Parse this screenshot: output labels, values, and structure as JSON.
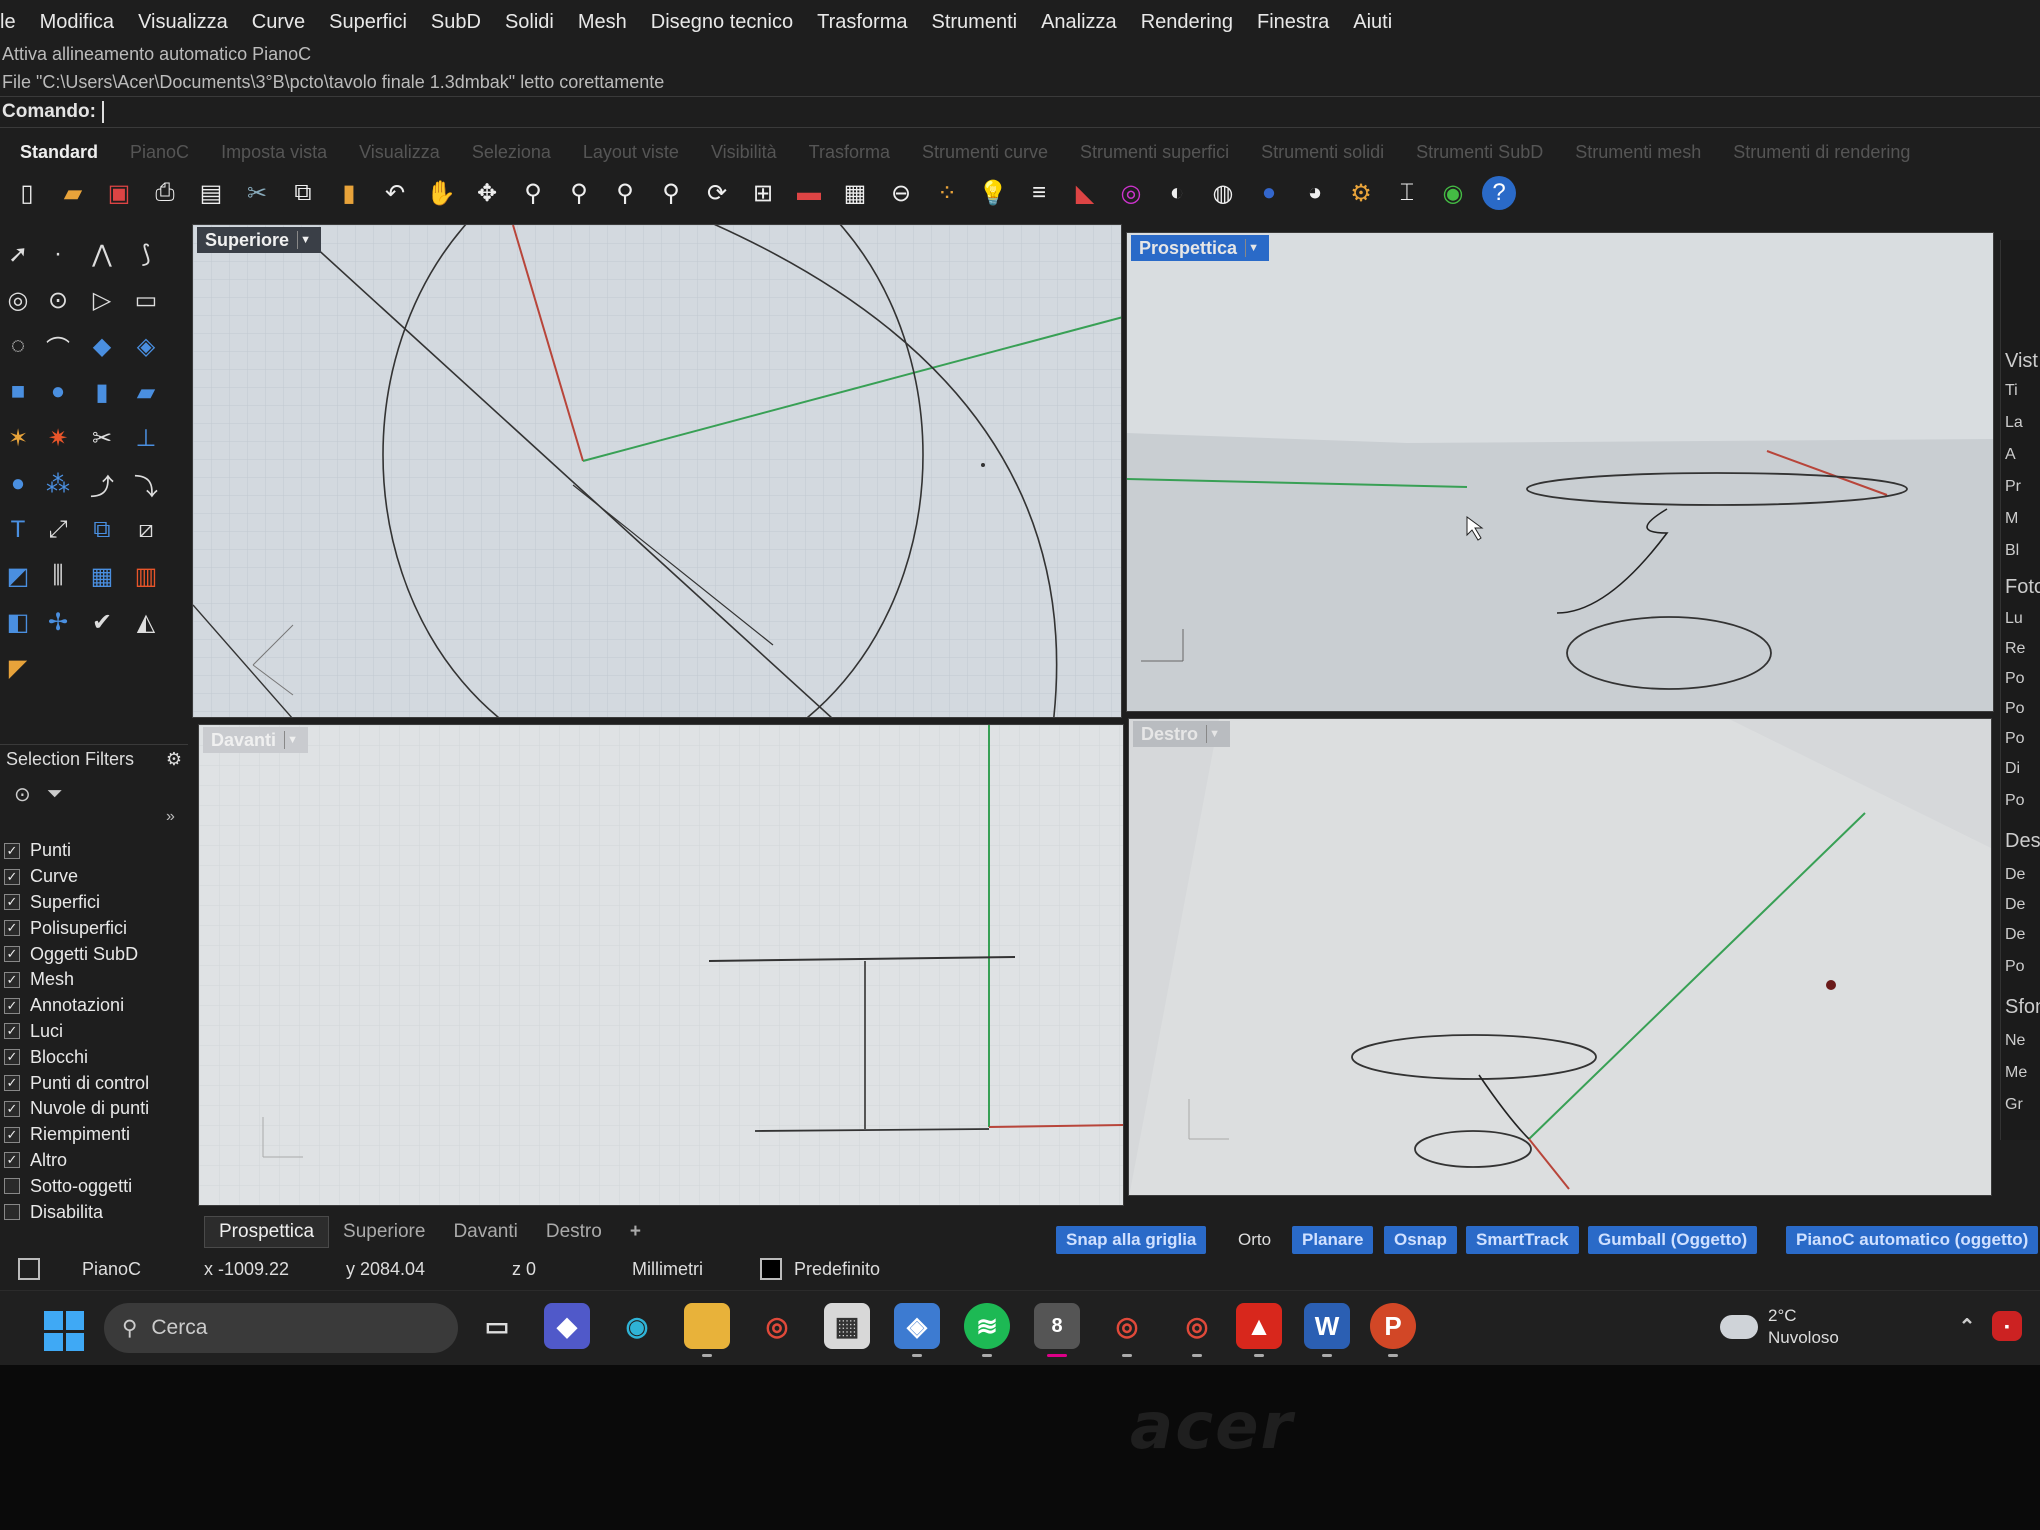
{
  "menu": [
    "le",
    "Modifica",
    "Visualizza",
    "Curve",
    "Superfici",
    "SubD",
    "Solidi",
    "Mesh",
    "Disegno tecnico",
    "Trasforma",
    "Strumenti",
    "Analizza",
    "Rendering",
    "Finestra",
    "Aiuti"
  ],
  "command_history": [
    "Attiva allineamento automatico PianoC",
    "File \"C:\\Users\\Acer\\Documents\\3°B\\pcto\\tavolo finale 1.3dmbak\" letto corettamente"
  ],
  "command_prompt": "Comando:",
  "toolbar_tabs": [
    "Standard",
    "PianoC",
    "Imposta vista",
    "Visualizza",
    "Seleziona",
    "Layout viste",
    "Visibilità",
    "Trasforma",
    "Strumenti curve",
    "Strumenti superfici",
    "Strumenti solidi",
    "Strumenti SubD",
    "Strumenti mesh",
    "Strumenti di rendering"
  ],
  "toolbar_icons": [
    "new-icon",
    "open-icon",
    "save-icon",
    "print-icon",
    "import-icon",
    "cut-icon",
    "copy-icon",
    "paste-icon",
    "undo-icon",
    "pan-icon",
    "rotate-view-icon",
    "zoom-icon",
    "zoom-window-icon",
    "zoom-extents-icon",
    "zoom-selected-icon",
    "rotate-camera-icon",
    "four-viewports-icon",
    "car-icon",
    "grid-icon",
    "snap-icon",
    "points-icon",
    "light-icon",
    "layer-icon",
    "material-icon",
    "color-wheel-icon",
    "sphere-icon",
    "mesh-sphere-icon",
    "render-sphere-icon",
    "render-icon",
    "gear-icon",
    "dimension-icon",
    "plugin-icon",
    "help-icon"
  ],
  "viewports": {
    "top": {
      "title": "Superiore"
    },
    "perspective": {
      "title": "Prospettica"
    },
    "front": {
      "title": "Davanti"
    },
    "right": {
      "title": "Destro"
    }
  },
  "selection_filters": {
    "title": "Selection Filters",
    "items": [
      {
        "label": "Punti",
        "checked": true
      },
      {
        "label": "Curve",
        "checked": true
      },
      {
        "label": "Superfici",
        "checked": true
      },
      {
        "label": "Polisuperfici",
        "checked": true
      },
      {
        "label": "Oggetti SubD",
        "checked": true
      },
      {
        "label": "Mesh",
        "checked": true
      },
      {
        "label": "Annotazioni",
        "checked": true
      },
      {
        "label": "Luci",
        "checked": true
      },
      {
        "label": "Blocchi",
        "checked": true
      },
      {
        "label": "Punti di control",
        "checked": true
      },
      {
        "label": "Nuvole di punti",
        "checked": true
      },
      {
        "label": "Riempimenti",
        "checked": true
      },
      {
        "label": "Altro",
        "checked": true
      },
      {
        "label": "Sotto-oggetti",
        "checked": false
      },
      {
        "label": "Disabilita",
        "checked": false
      }
    ]
  },
  "right_panel": [
    "Vist",
    "Ti",
    "La",
    "A",
    "Pr",
    "M",
    "Bl",
    "Foto",
    "Lu",
    "Re",
    "Po",
    "Po",
    "Po",
    "Di",
    "Po",
    "Dest",
    "De",
    "De",
    "De",
    "Po",
    "Sfon",
    "Ne",
    "Me",
    "Gr"
  ],
  "viewport_tabs": [
    "Prospettica",
    "Superiore",
    "Davanti",
    "Destro",
    "+"
  ],
  "status": {
    "plane": "PianoC",
    "x": "x -1009.22",
    "y": "y 2084.04",
    "z": "z 0",
    "units": "Millimetri",
    "layer": "Predefinito",
    "toggles": [
      {
        "label": "Snap alla griglia",
        "on": true
      },
      {
        "label": "Orto",
        "on": false
      },
      {
        "label": "Planare",
        "on": true
      },
      {
        "label": "Osnap",
        "on": true
      },
      {
        "label": "SmartTrack",
        "on": true
      },
      {
        "label": "Gumball (Oggetto)",
        "on": true
      },
      {
        "label": "PianoC automatico (oggetto)",
        "on": true
      }
    ]
  },
  "taskbar": {
    "search_placeholder": "Cerca",
    "weather_temp": "2°C",
    "weather_desc": "Nuvoloso",
    "rhino_badge": "8",
    "word_letter": "W"
  },
  "bezel_logo": "acer",
  "colors": {
    "accent": "#2a6ac8",
    "viewport_bg": "#d6dbe0",
    "x_axis": "#c0392b",
    "y_axis": "#2fa84f"
  }
}
